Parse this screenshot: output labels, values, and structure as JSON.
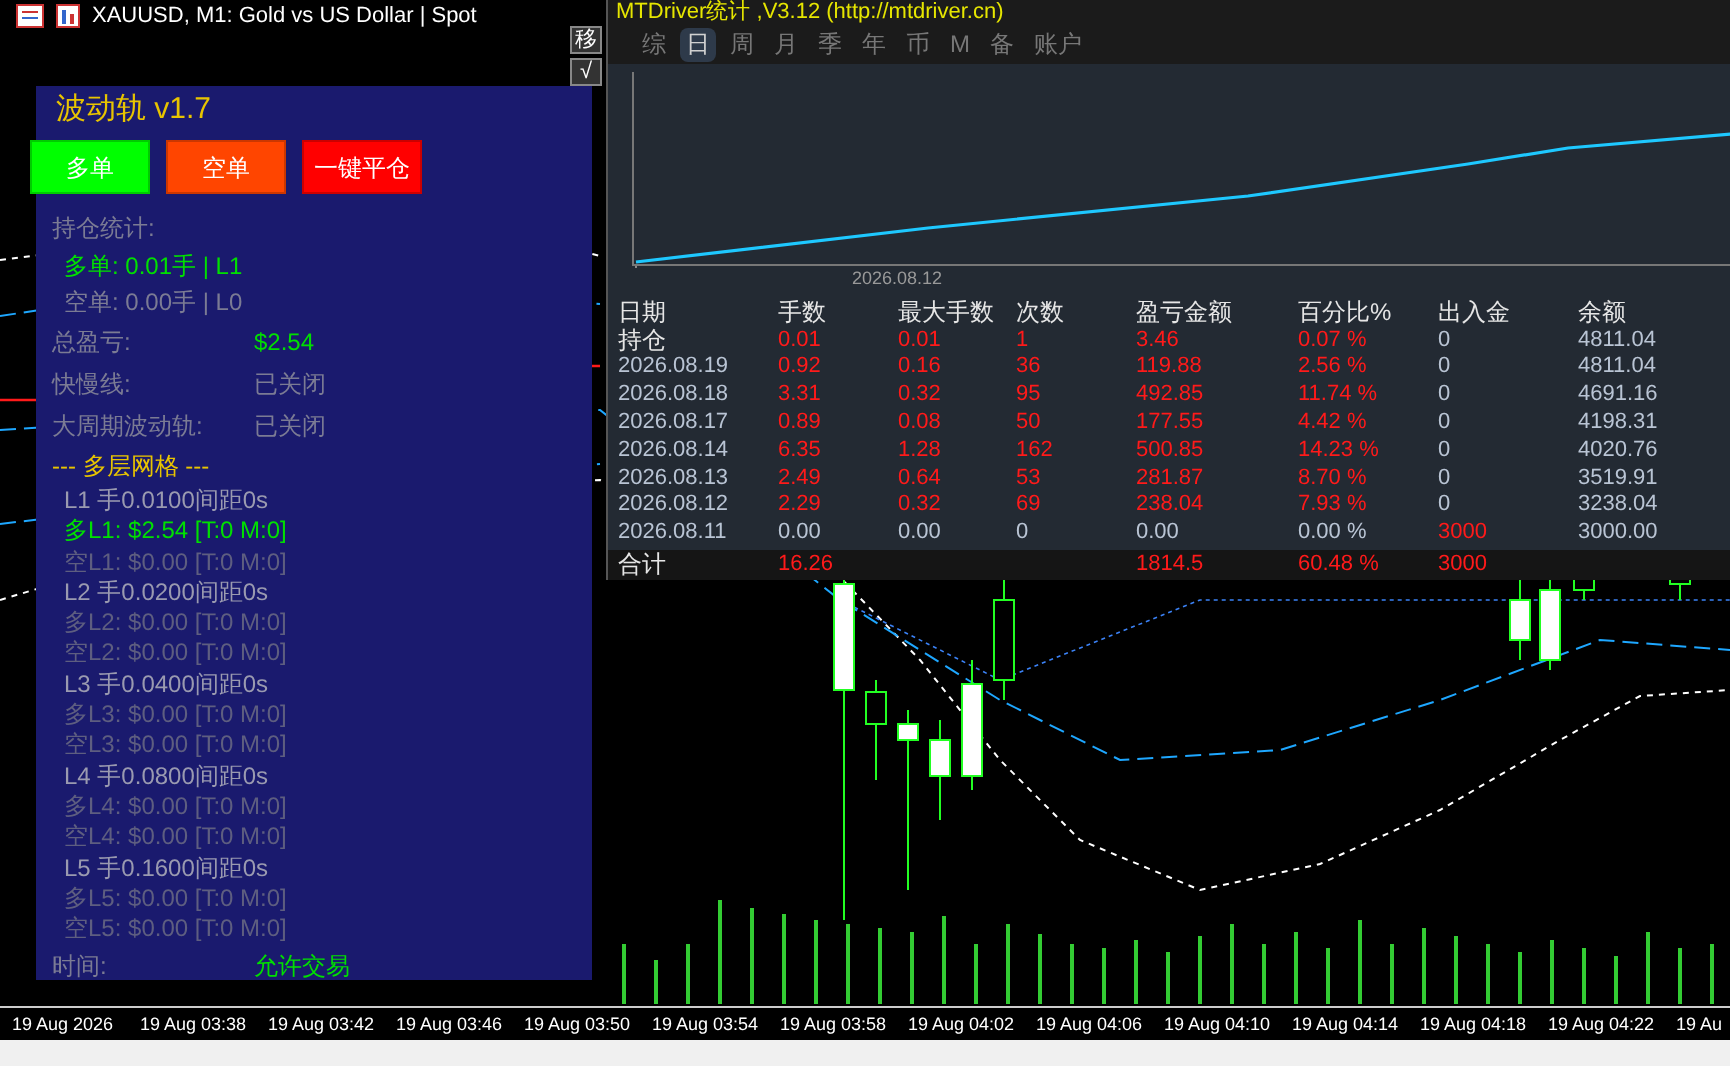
{
  "chart_window": {
    "title": "XAUUSD, M1: Gold vs US Dollar | Spot",
    "side_buttons": [
      "移",
      "√"
    ],
    "time_axis": [
      "19 Aug 2026",
      "19 Aug 03:38",
      "19 Aug 03:42",
      "19 Aug 03:46",
      "19 Aug 03:50",
      "19 Aug 03:54",
      "19 Aug 03:58",
      "19 Aug 04:02",
      "19 Aug 04:06",
      "19 Aug 04:10",
      "19 Aug 04:14",
      "19 Aug 04:18",
      "19 Aug 04:22",
      "19 Au"
    ]
  },
  "ea_panel": {
    "title": "波动轨 v1.7",
    "buttons": [
      {
        "label": "多单",
        "color": "#00ff00"
      },
      {
        "label": "空单",
        "color": "#ff4500"
      },
      {
        "label": "一键平仓",
        "color": "#ff0000"
      }
    ],
    "lines": [
      {
        "kind": "label",
        "text": "持仓统计:"
      },
      {
        "kind": "position",
        "text": "多单: 0.01手 | L1",
        "active": true
      },
      {
        "kind": "position",
        "text": "空单: 0.00手 | L0",
        "active": false
      },
      {
        "kind": "pair",
        "text": "总盈亏:",
        "value": "$2.54",
        "active": true
      },
      {
        "kind": "pair",
        "text": "快慢线:",
        "value": "已关闭",
        "active": false
      },
      {
        "kind": "pair",
        "text": "大周期波动轨:",
        "value": "已关闭",
        "active": false
      },
      {
        "kind": "heading",
        "text": "--- 多层网格 ---"
      },
      {
        "kind": "level",
        "text": "L1 手0.0100间距0s"
      },
      {
        "kind": "grid",
        "text": "多L1: $2.54 [T:0 M:0]",
        "active": true
      },
      {
        "kind": "grid",
        "text": "空L1: $0.00 [T:0 M:0]",
        "active": false
      },
      {
        "kind": "level",
        "text": "L2 手0.0200间距0s"
      },
      {
        "kind": "grid",
        "text": "多L2: $0.00 [T:0 M:0]",
        "active": false
      },
      {
        "kind": "grid",
        "text": "空L2: $0.00 [T:0 M:0]",
        "active": false
      },
      {
        "kind": "level",
        "text": "L3 手0.0400间距0s"
      },
      {
        "kind": "grid",
        "text": "多L3: $0.00 [T:0 M:0]",
        "active": false
      },
      {
        "kind": "grid",
        "text": "空L3: $0.00 [T:0 M:0]",
        "active": false
      },
      {
        "kind": "level",
        "text": "L4 手0.0800间距0s"
      },
      {
        "kind": "grid",
        "text": "多L4: $0.00 [T:0 M:0]",
        "active": false
      },
      {
        "kind": "grid",
        "text": "空L4: $0.00 [T:0 M:0]",
        "active": false
      },
      {
        "kind": "level",
        "text": "L5 手0.1600间距0s"
      },
      {
        "kind": "grid",
        "text": "多L5: $0.00 [T:0 M:0]",
        "active": false
      },
      {
        "kind": "grid",
        "text": "空L5: $0.00 [T:0 M:0]",
        "active": false
      },
      {
        "kind": "pair",
        "text": "时间:",
        "value": "允许交易",
        "active": true
      }
    ]
  },
  "stats_window": {
    "title": "MTDriver统计 ,V3.12 (http://mtdriver.cn)",
    "tabs": [
      {
        "label": "综",
        "selected": false
      },
      {
        "label": "日",
        "selected": true
      },
      {
        "label": "周",
        "selected": false
      },
      {
        "label": "月",
        "selected": false
      },
      {
        "label": "季",
        "selected": false
      },
      {
        "label": "年",
        "selected": false
      },
      {
        "label": "币",
        "selected": false
      },
      {
        "label": "M",
        "selected": false
      },
      {
        "label": "备",
        "selected": false
      },
      {
        "label": "账户",
        "selected": false
      }
    ],
    "equity_chart": {
      "date_label": "2026.08.12"
    },
    "table": {
      "columns": [
        "日期",
        "手数",
        "最大手数",
        "次数",
        "盈亏金额",
        "百分比%",
        "出入金",
        "余额"
      ],
      "rows": [
        {
          "kind": "open",
          "date": "持仓",
          "balance": "4811.04",
          "values": [
            {
              "text": "0.01",
              "red": true
            },
            {
              "text": "0.01",
              "red": true
            },
            {
              "text": "1",
              "red": true
            },
            {
              "text": "3.46",
              "red": true
            },
            {
              "text": "0.07 %",
              "red": true
            },
            {
              "text": "0",
              "red": false
            }
          ]
        },
        {
          "kind": "day",
          "date": "2026.08.19",
          "balance": "4811.04",
          "values": [
            {
              "text": "0.92",
              "red": true
            },
            {
              "text": "0.16",
              "red": true
            },
            {
              "text": "36",
              "red": true
            },
            {
              "text": "119.88",
              "red": true
            },
            {
              "text": "2.56 %",
              "red": true
            },
            {
              "text": "0",
              "red": false
            }
          ]
        },
        {
          "kind": "day",
          "date": "2026.08.18",
          "balance": "4691.16",
          "values": [
            {
              "text": "3.31",
              "red": true
            },
            {
              "text": "0.32",
              "red": true
            },
            {
              "text": "95",
              "red": true
            },
            {
              "text": "492.85",
              "red": true
            },
            {
              "text": "11.74 %",
              "red": true
            },
            {
              "text": "0",
              "red": false
            }
          ]
        },
        {
          "kind": "day",
          "date": "2026.08.17",
          "balance": "4198.31",
          "values": [
            {
              "text": "0.89",
              "red": true
            },
            {
              "text": "0.08",
              "red": true
            },
            {
              "text": "50",
              "red": true
            },
            {
              "text": "177.55",
              "red": true
            },
            {
              "text": "4.42 %",
              "red": true
            },
            {
              "text": "0",
              "red": false
            }
          ]
        },
        {
          "kind": "day",
          "date": "2026.08.14",
          "balance": "4020.76",
          "values": [
            {
              "text": "6.35",
              "red": true
            },
            {
              "text": "1.28",
              "red": true
            },
            {
              "text": "162",
              "red": true
            },
            {
              "text": "500.85",
              "red": true
            },
            {
              "text": "14.23 %",
              "red": true
            },
            {
              "text": "0",
              "red": false
            }
          ]
        },
        {
          "kind": "day",
          "date": "2026.08.13",
          "balance": "3519.91",
          "values": [
            {
              "text": "2.49",
              "red": true
            },
            {
              "text": "0.64",
              "red": true
            },
            {
              "text": "53",
              "red": true
            },
            {
              "text": "281.87",
              "red": true
            },
            {
              "text": "8.70 %",
              "red": true
            },
            {
              "text": "0",
              "red": false
            }
          ]
        },
        {
          "kind": "day",
          "date": "2026.08.12",
          "balance": "3238.04",
          "values": [
            {
              "text": "2.29",
              "red": true
            },
            {
              "text": "0.32",
              "red": true
            },
            {
              "text": "69",
              "red": true
            },
            {
              "text": "238.04",
              "red": true
            },
            {
              "text": "7.93 %",
              "red": true
            },
            {
              "text": "0",
              "red": false
            }
          ]
        },
        {
          "kind": "day",
          "date": "2026.08.11",
          "balance": "3000.00",
          "values": [
            {
              "text": "0.00",
              "red": false
            },
            {
              "text": "0.00",
              "red": false
            },
            {
              "text": "0",
              "red": false
            },
            {
              "text": "0.00",
              "red": false
            },
            {
              "text": "0.00 %",
              "red": false
            },
            {
              "text": "3000",
              "red": true
            }
          ]
        }
      ],
      "total": {
        "label": "合计",
        "lots": "16.26",
        "profit": "1814.5",
        "percent": "60.48 %",
        "deposit": "3000"
      }
    }
  }
}
